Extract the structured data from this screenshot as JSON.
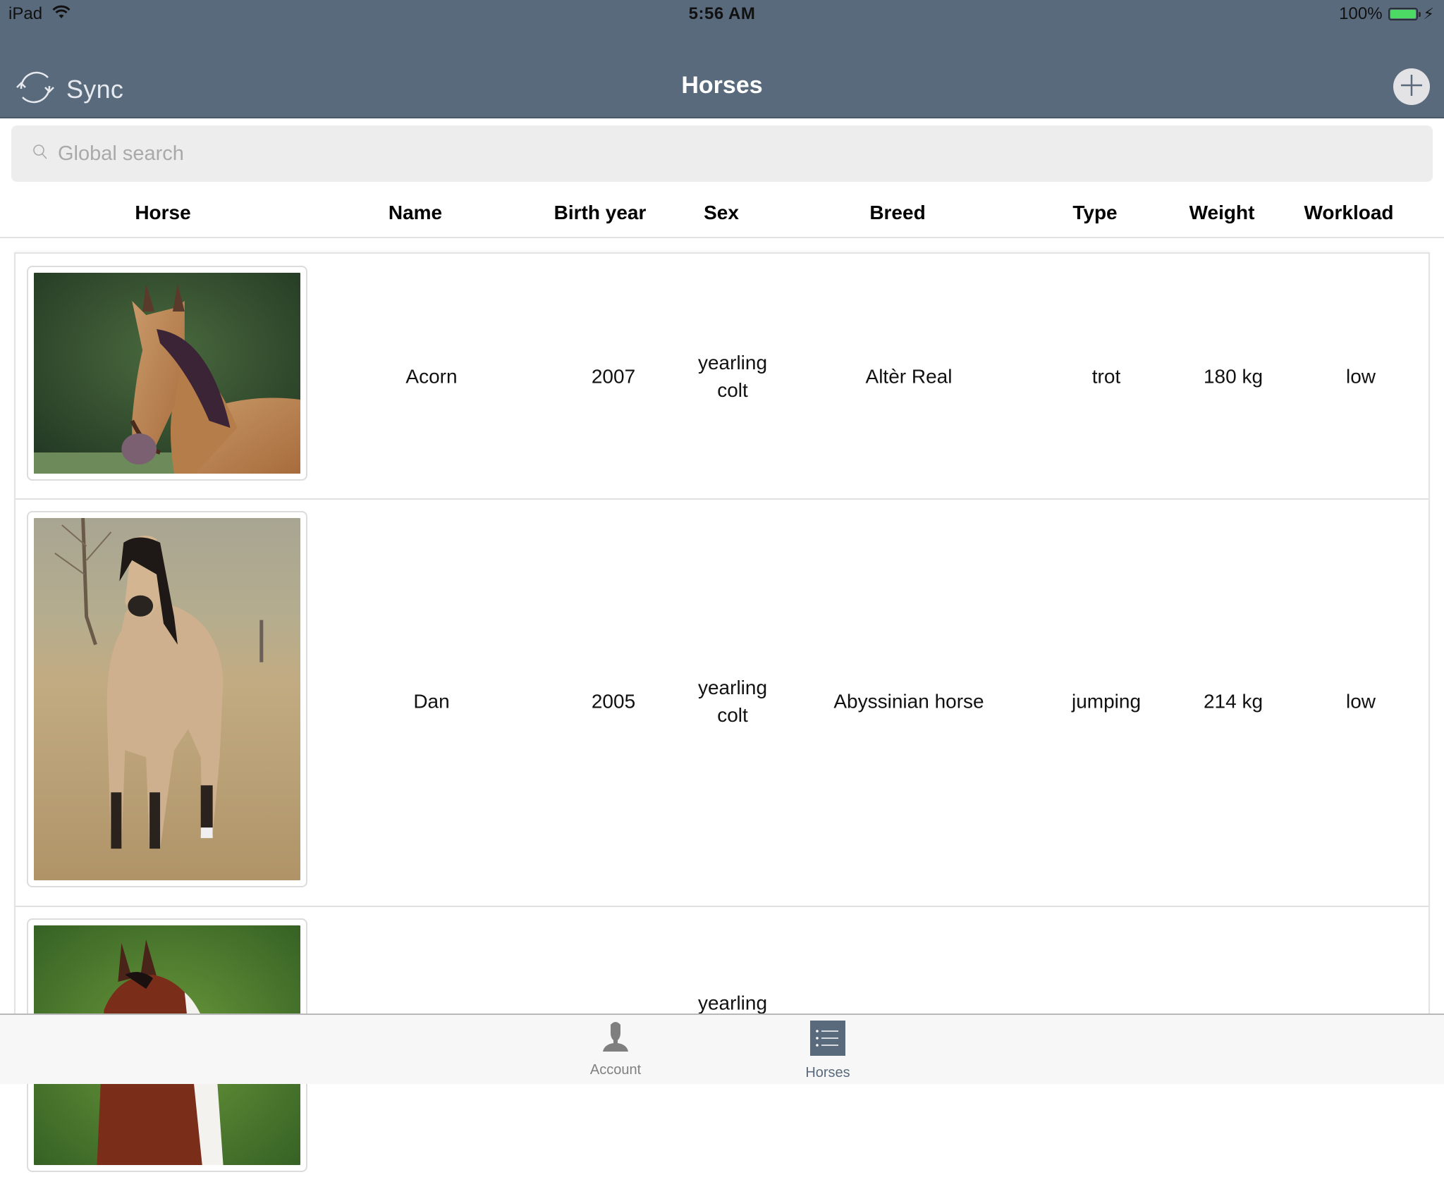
{
  "status_bar": {
    "device": "iPad",
    "time": "5:56 AM",
    "battery": "100%",
    "battery_level": 1.0,
    "wifi_icon": "wifi-icon",
    "charging_icon": "bolt-icon"
  },
  "nav": {
    "title": "Horses",
    "sync_label": "Sync",
    "sync_icon": "sync-icon",
    "add_icon": "plus-icon"
  },
  "search": {
    "placeholder": "Global search",
    "value": "",
    "icon": "search-icon"
  },
  "table": {
    "columns": [
      "Horse",
      "Name",
      "Birth year",
      "Sex",
      "Breed",
      "Type",
      "Weight",
      "Workload"
    ],
    "rows": [
      {
        "photo": "buckskin horse with halter, head and neck, green background",
        "name": "Acorn",
        "birth_year": "2007",
        "sex_line1": "yearling",
        "sex_line2": "colt",
        "breed": "Altèr Real",
        "type": "trot",
        "weight": "180 kg",
        "workload": "low"
      },
      {
        "photo": "dun horse standing in dry grass field",
        "name": "Dan",
        "birth_year": "2005",
        "sex_line1": "yearling",
        "sex_line2": "colt",
        "breed": "Abyssinian horse",
        "type": "jumping",
        "weight": "214 kg",
        "workload": "low"
      },
      {
        "photo": "chestnut and white paint horse head, green background",
        "name": "",
        "birth_year": "",
        "sex_line1": "yearling",
        "sex_line2": "",
        "breed": "",
        "type": "",
        "weight": "",
        "workload": ""
      }
    ]
  },
  "tabbar": {
    "tabs": [
      {
        "label": "Account",
        "icon": "person-icon",
        "active": false
      },
      {
        "label": "Horses",
        "icon": "list-icon",
        "active": true
      }
    ]
  },
  "colors": {
    "nav_bg": "#5a6a7d",
    "search_bg": "#ededed",
    "active_tab": "#5a6a7d",
    "inactive_tab": "#808080",
    "battery_fill": "#4cd964"
  }
}
